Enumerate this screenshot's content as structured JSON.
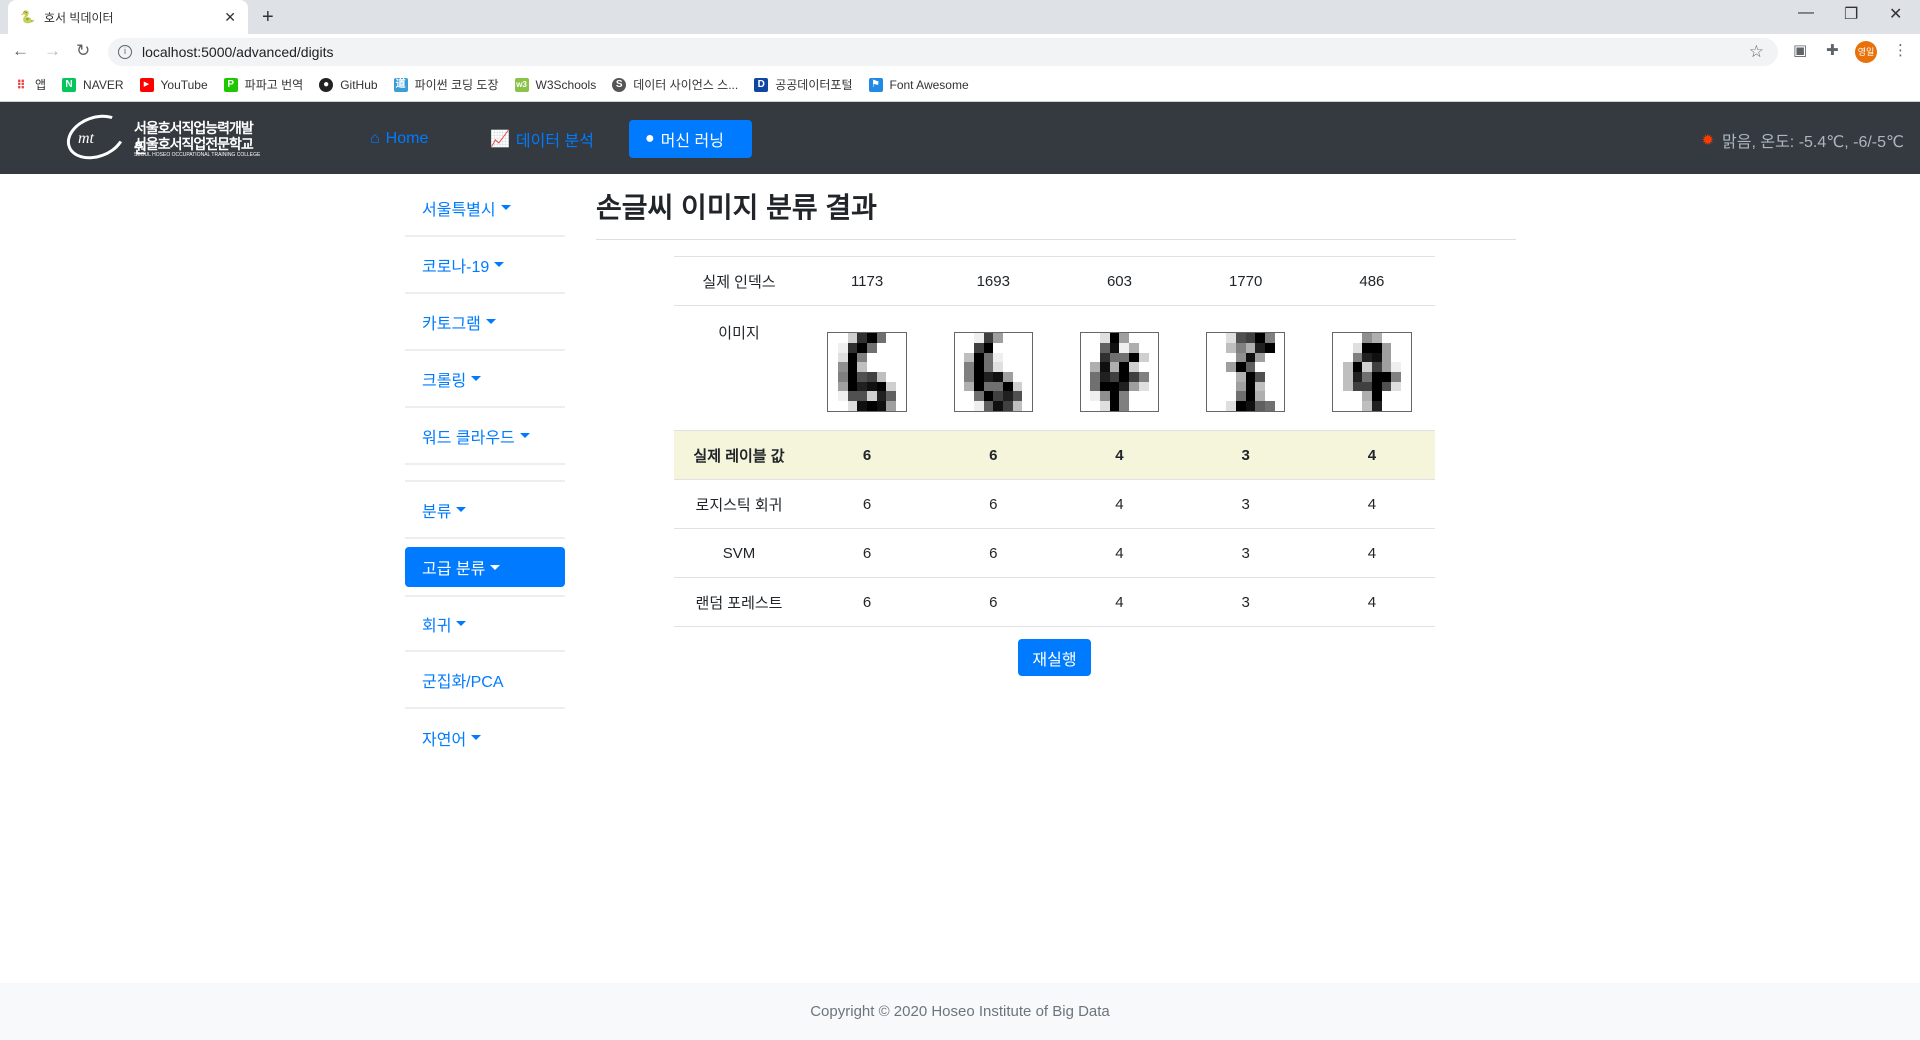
{
  "browser": {
    "tab_title": "호서 빅데이터",
    "url": "localhost:5000/advanced/digits",
    "profile": "영일",
    "bookmarks": [
      "앱",
      "NAVER",
      "YouTube",
      "파파고 번역",
      "GitHub",
      "파이썬 코딩 도장",
      "W3Schools",
      "데이터 사이언스 스...",
      "공공데이터포털",
      "Font Awesome"
    ]
  },
  "navbar": {
    "logo": {
      "line1": "서울호서직업능력개발원",
      "line2": "서울호서직업전문학교",
      "line3": "SEOUL HOSEO OCCUPATIONAL TRAINING COLLEGE"
    },
    "links": [
      {
        "label": "Home",
        "icon": "home-icon",
        "active": false
      },
      {
        "label": "데이터 분석",
        "icon": "chart-line-icon",
        "active": false
      },
      {
        "label": "머신 러닝",
        "icon": "brain-icon",
        "active": true
      }
    ],
    "weather": "맑음, 온도: -5.4℃, -6/-5℃"
  },
  "sidebar": {
    "items": [
      {
        "label": "서울특별시",
        "dropdown": true
      },
      {
        "label": "코로나-19",
        "dropdown": true
      },
      {
        "label": "카토그램",
        "dropdown": true
      },
      {
        "label": "크롤링",
        "dropdown": true
      },
      {
        "label": "워드 클라우드",
        "dropdown": true
      },
      {
        "label": "분류",
        "dropdown": true
      },
      {
        "label": "고급 분류",
        "dropdown": true,
        "active": true
      },
      {
        "label": "회귀",
        "dropdown": true
      },
      {
        "label": "군집화/PCA",
        "dropdown": false
      },
      {
        "label": "자연어",
        "dropdown": true
      }
    ]
  },
  "main": {
    "title": "손글씨 이미지 분류 결과",
    "table": {
      "index_label": "실제 인덱스",
      "indices": [
        "1173",
        "1693",
        "603",
        "1770",
        "486"
      ],
      "image_label": "이미지",
      "rows": [
        {
          "label": "실제 레이블 값",
          "values": [
            "6",
            "6",
            "4",
            "3",
            "4"
          ],
          "highlight": true
        },
        {
          "label": "로지스틱 회귀",
          "values": [
            "6",
            "6",
            "4",
            "3",
            "4"
          ]
        },
        {
          "label": "SVM",
          "values": [
            "6",
            "6",
            "4",
            "3",
            "4"
          ]
        },
        {
          "label": "랜덤 포레스트",
          "values": [
            "6",
            "6",
            "4",
            "3",
            "4"
          ]
        }
      ],
      "images": [
        [
          [
            0,
            0,
            3,
            13,
            16,
            9,
            0,
            0
          ],
          [
            0,
            1,
            13,
            16,
            9,
            0,
            0,
            0
          ],
          [
            0,
            2,
            16,
            8,
            0,
            0,
            0,
            0
          ],
          [
            0,
            7,
            16,
            4,
            0,
            0,
            0,
            0
          ],
          [
            0,
            8,
            16,
            11,
            12,
            4,
            0,
            0
          ],
          [
            0,
            6,
            16,
            14,
            15,
            16,
            3,
            0
          ],
          [
            0,
            1,
            11,
            11,
            3,
            14,
            10,
            0
          ],
          [
            0,
            0,
            2,
            15,
            16,
            15,
            6,
            0
          ]
        ],
        [
          [
            0,
            0,
            1,
            12,
            6,
            0,
            0,
            0
          ],
          [
            0,
            0,
            12,
            16,
            0,
            0,
            0,
            0
          ],
          [
            0,
            4,
            16,
            9,
            1,
            0,
            0,
            0
          ],
          [
            0,
            8,
            16,
            9,
            2,
            0,
            0,
            0
          ],
          [
            0,
            8,
            16,
            14,
            15,
            6,
            0,
            0
          ],
          [
            0,
            5,
            16,
            9,
            9,
            16,
            3,
            0
          ],
          [
            0,
            0,
            9,
            16,
            12,
            14,
            11,
            0
          ],
          [
            0,
            0,
            1,
            10,
            15,
            12,
            4,
            0
          ]
        ],
        [
          [
            0,
            0,
            2,
            16,
            6,
            0,
            0,
            0
          ],
          [
            0,
            0,
            10,
            15,
            1,
            5,
            0,
            0
          ],
          [
            0,
            0,
            13,
            9,
            9,
            16,
            3,
            0
          ],
          [
            0,
            5,
            15,
            5,
            16,
            3,
            0,
            0
          ],
          [
            0,
            9,
            14,
            12,
            16,
            12,
            8,
            0
          ],
          [
            0,
            9,
            16,
            16,
            14,
            6,
            2,
            0
          ],
          [
            0,
            1,
            7,
            16,
            8,
            0,
            0,
            0
          ],
          [
            0,
            0,
            2,
            16,
            8,
            0,
            0,
            0
          ]
        ],
        [
          [
            0,
            0,
            2,
            11,
            12,
            16,
            8,
            0
          ],
          [
            0,
            0,
            4,
            8,
            5,
            14,
            16,
            0
          ],
          [
            0,
            0,
            0,
            7,
            15,
            6,
            0,
            0
          ],
          [
            0,
            0,
            6,
            16,
            10,
            0,
            0,
            0
          ],
          [
            0,
            0,
            0,
            5,
            16,
            11,
            0,
            0
          ],
          [
            0,
            0,
            0,
            6,
            16,
            4,
            0,
            0
          ],
          [
            0,
            0,
            0,
            9,
            16,
            5,
            0,
            0
          ],
          [
            0,
            0,
            2,
            16,
            15,
            10,
            9,
            0
          ]
        ],
        [
          [
            0,
            0,
            0,
            7,
            5,
            0,
            0,
            0
          ],
          [
            0,
            0,
            2,
            16,
            16,
            6,
            0,
            0
          ],
          [
            0,
            0,
            8,
            14,
            15,
            6,
            0,
            0
          ],
          [
            0,
            4,
            16,
            3,
            12,
            6,
            1,
            0
          ],
          [
            0,
            4,
            14,
            9,
            16,
            16,
            8,
            0
          ],
          [
            0,
            4,
            12,
            12,
            16,
            11,
            2,
            0
          ],
          [
            0,
            0,
            0,
            5,
            16,
            0,
            0,
            0
          ],
          [
            0,
            0,
            0,
            4,
            14,
            0,
            0,
            0
          ]
        ]
      ]
    },
    "rerun_label": "재실행"
  },
  "footer": {
    "text": "Copyright © 2020 Hoseo Institute of Big Data"
  },
  "colors": {
    "primary": "#007bff",
    "navbar": "#343a40",
    "highlight_row": "#f5f5dc"
  }
}
